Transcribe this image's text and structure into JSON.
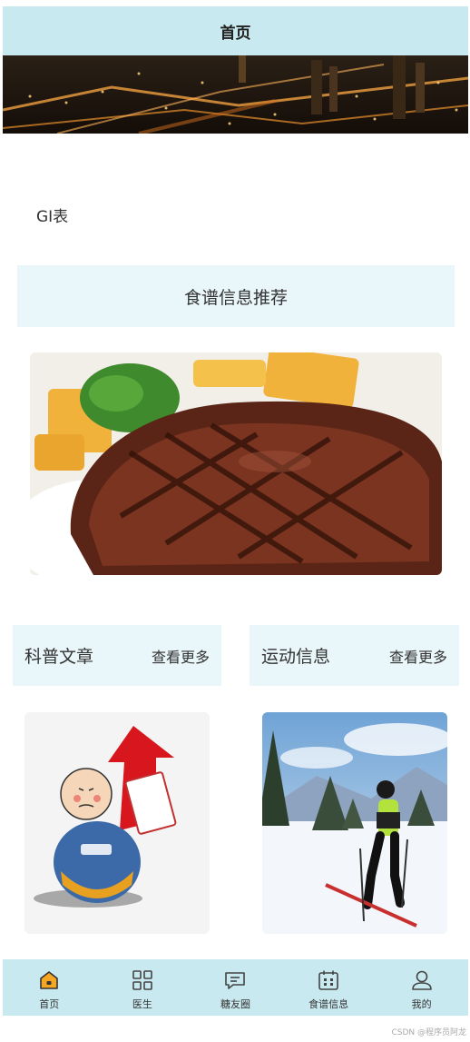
{
  "header": {
    "title": "首页"
  },
  "gi_label": "GI表",
  "recipe_section": {
    "title": "食谱信息推荐"
  },
  "cards": [
    {
      "title": "科普文章",
      "more": "查看更多"
    },
    {
      "title": "运动信息",
      "more": "查看更多"
    }
  ],
  "tabbar": [
    {
      "label": "首页",
      "icon": "home-icon",
      "active": true
    },
    {
      "label": "医生",
      "icon": "grid-icon"
    },
    {
      "label": "糖友圈",
      "icon": "message-icon"
    },
    {
      "label": "食谱信息",
      "icon": "calendar-icon"
    },
    {
      "label": "我的",
      "icon": "user-icon"
    }
  ],
  "watermark": "CSDN @程序员阿龙",
  "colors": {
    "header_bg": "#c8e9ef",
    "section_bg": "#e9f6fa",
    "active_icon": "#f5a623"
  }
}
